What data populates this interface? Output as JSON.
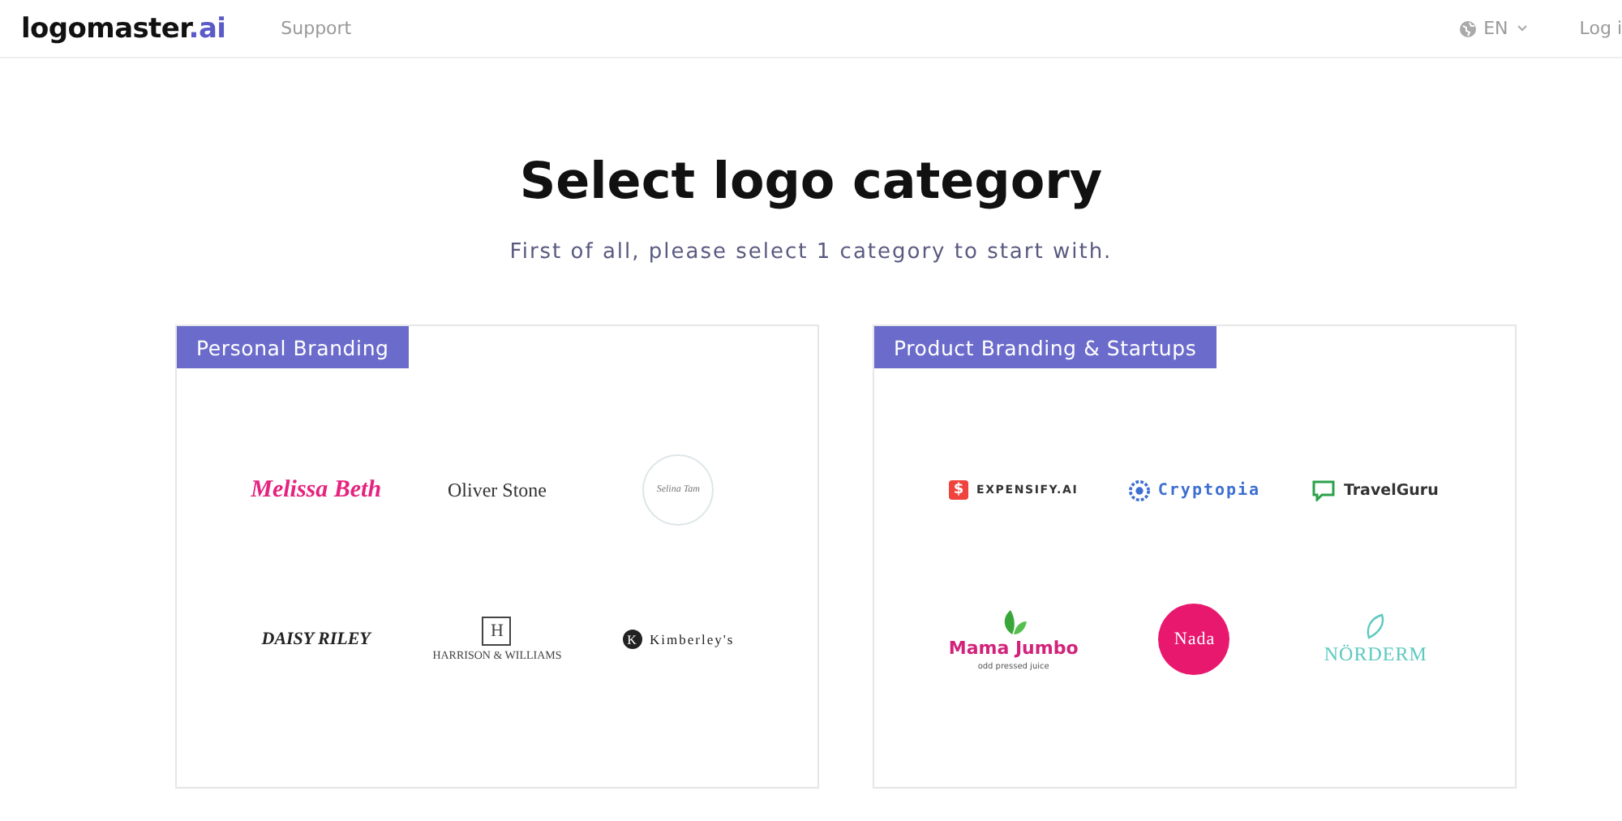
{
  "header": {
    "brand": "logomaster",
    "brand_suffix": ".ai",
    "nav": [
      "Support"
    ],
    "language": "EN",
    "login": "Log i"
  },
  "title": "Select logo category",
  "subtitle": "First of all, please select 1 category to start with.",
  "categories": [
    {
      "label": "Personal Branding",
      "logos": [
        {
          "kind": "script",
          "name": "Melissa Beth",
          "color": "#e5237f"
        },
        {
          "kind": "caps",
          "name": "Oliver Stone",
          "color": "#333333"
        },
        {
          "kind": "ring",
          "name": "Selina Tam",
          "color": "#777777"
        },
        {
          "kind": "bold",
          "name": "DAISY RILEY",
          "color": "#222222"
        },
        {
          "kind": "monogram",
          "name": "HARRISON & WILLIAMS",
          "mark": "H",
          "color": "#444444"
        },
        {
          "kind": "badge",
          "name": "Kimberley's",
          "mark": "K",
          "color": "#222222"
        }
      ]
    },
    {
      "label": "Product Branding & Startups",
      "logos": [
        {
          "kind": "square",
          "name": "EXPENSIFY.AI",
          "mark": "$",
          "color": "#f0433d"
        },
        {
          "kind": "gear",
          "name": "Cryptopia",
          "color": "#3d6fd1"
        },
        {
          "kind": "chat",
          "name": "TravelGuru",
          "color": "#2aa14a"
        },
        {
          "kind": "leaf",
          "name": "Mama Jumbo",
          "tagline": "odd pressed juice",
          "color": "#d1237a"
        },
        {
          "kind": "disc",
          "name": "Nada",
          "color": "#e8186f"
        },
        {
          "kind": "feather",
          "name": "NÖRDERM",
          "color": "#5cc9c0"
        }
      ]
    }
  ]
}
